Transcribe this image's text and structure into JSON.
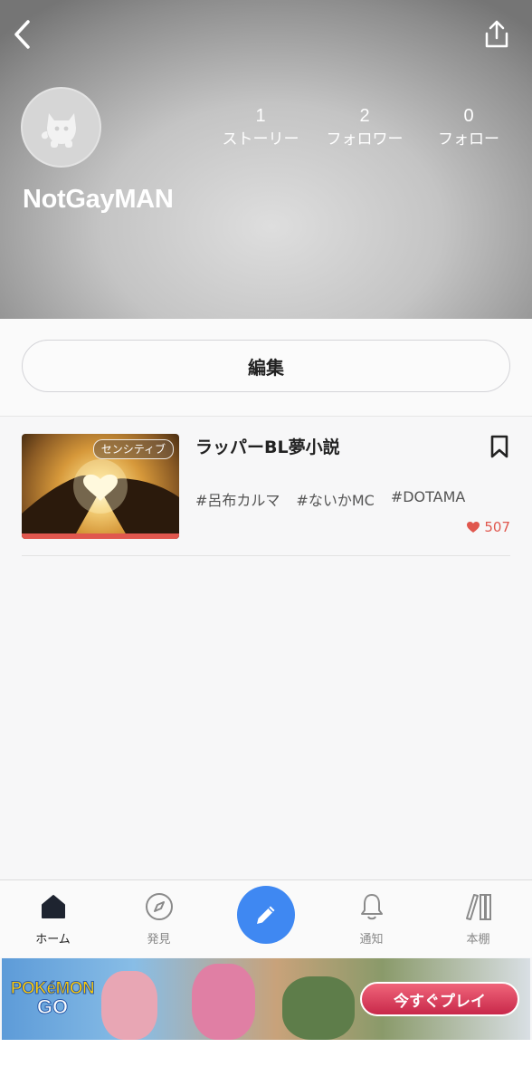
{
  "profile": {
    "username": "NotGayMAN",
    "stats": [
      {
        "count": "1",
        "label": "ストーリー"
      },
      {
        "count": "2",
        "label": "フォロワー"
      },
      {
        "count": "0",
        "label": "フォロー"
      }
    ]
  },
  "edit_label": "編集",
  "stories": [
    {
      "title": "ラッパーBL夢小説",
      "badge": "センシティブ",
      "tags": [
        "#呂布カルマ",
        "#ないかMC",
        "#DOTAMA"
      ],
      "likes": "507"
    }
  ],
  "nav": {
    "home": "ホーム",
    "discover": "発見",
    "notifications": "通知",
    "bookshelf": "本棚"
  },
  "ad": {
    "logo_top": "POKéMON",
    "logo_bottom": "GO",
    "cta": "今すぐプレイ"
  },
  "colors": {
    "accent": "#3f88f2",
    "like": "#e0574e"
  }
}
